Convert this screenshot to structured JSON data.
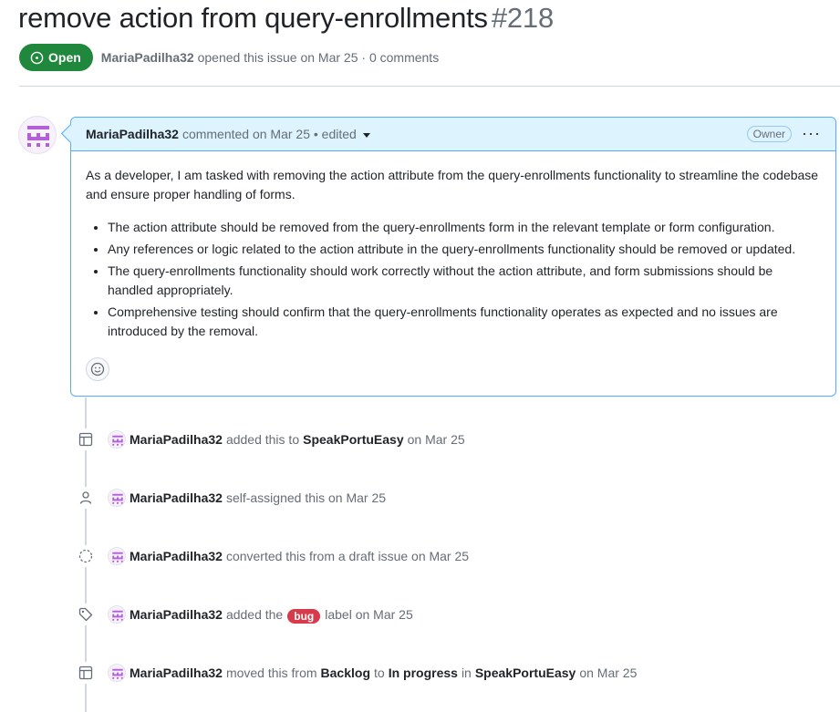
{
  "issue": {
    "title": "remove action from query-enrollments",
    "number": "#218",
    "state": "Open",
    "author": "MariaPadilha32",
    "meta": "opened this issue on Mar 25 · 0 comments"
  },
  "comment": {
    "author": "MariaPadilha32",
    "header_text": "commented on Mar 25 • edited",
    "owner_badge": "Owner",
    "menu": "···",
    "intro": "As a developer, I am tasked with removing the action attribute from the query-enrollments functionality to streamline the codebase and ensure proper handling of forms.",
    "bullets": [
      "The action attribute should be removed from the query-enrollments form in the relevant template or form configuration.",
      "Any references or logic related to the action attribute in the query-enrollments functionality should be removed or updated.",
      "The query-enrollments functionality should work correctly without the action attribute, and form submissions should be handled appropriately.",
      "Comprehensive testing should confirm that the query-enrollments functionality operates as expected and no issues are introduced by the removal."
    ]
  },
  "events": [
    {
      "icon": "table-icon",
      "author": "MariaPadilha32",
      "t1": "added this to",
      "b1": "SpeakPortuEasy",
      "t2": "on Mar 25"
    },
    {
      "icon": "person-icon",
      "author": "MariaPadilha32",
      "t1": "self-assigned this on Mar 25"
    },
    {
      "icon": "dashed-circle-icon",
      "author": "MariaPadilha32",
      "t1": "converted this from a draft issue on Mar 25"
    },
    {
      "icon": "tag-icon",
      "author": "MariaPadilha32",
      "t1": "added the",
      "label": "bug",
      "t2": "label on Mar 25"
    },
    {
      "icon": "table-icon",
      "author": "MariaPadilha32",
      "t1": "moved this from",
      "b1": "Backlog",
      "t2": "to",
      "b2": "In progress",
      "t3": "in",
      "b3": "SpeakPortuEasy",
      "t4": "on Mar 25"
    }
  ],
  "colors": {
    "open_green": "#1f883d",
    "comment_header_bg": "#ddf4ff",
    "comment_border": "#54aeff",
    "bug_label": "#d73a4a",
    "avatar_purple": "#b35fd6"
  }
}
